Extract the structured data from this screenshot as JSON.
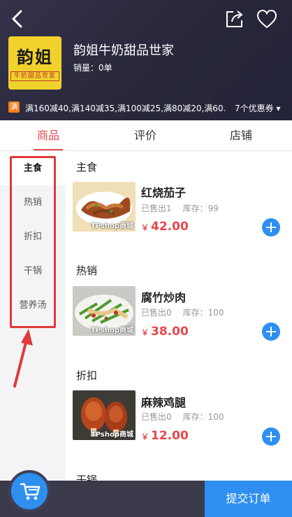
{
  "header": {
    "shop_name": "韵姐牛奶甜品世家",
    "sales": "销量：0单",
    "logo_big": "韵姐",
    "logo_small": "牛奶甜品世家",
    "promo_tag": "满",
    "promo_text": "满160减40,满140减35,满100减25,满80减20,满60...",
    "coupons": "7个优惠券 ▾"
  },
  "tabs": [
    {
      "label": "商品"
    },
    {
      "label": "评价"
    },
    {
      "label": "店铺"
    }
  ],
  "sidebar": {
    "items": [
      {
        "label": "主食"
      },
      {
        "label": "热销"
      },
      {
        "label": "折扣"
      },
      {
        "label": "干锅"
      },
      {
        "label": "营养汤"
      }
    ]
  },
  "sections": [
    {
      "title": "主食",
      "item": {
        "name": "红烧茄子",
        "sold": "已售出1",
        "stock": "库存：99",
        "currency": "￥",
        "price": "42.00",
        "watermark": "TPshop商城"
      }
    },
    {
      "title": "热销",
      "item": {
        "name": "腐竹炒肉",
        "sold": "已售出0",
        "stock": "库存：100",
        "currency": "￥",
        "price": "38.00",
        "watermark": "TPshop商城"
      }
    },
    {
      "title": "折扣",
      "item": {
        "name": "麻辣鸡腿",
        "sold": "已售出0",
        "stock": "库存：100",
        "currency": "￥",
        "price": "12.00",
        "watermark": "TPshop商城"
      }
    },
    {
      "title": "干锅"
    }
  ],
  "footer": {
    "submit_label": "提交订单"
  },
  "icons": {
    "back": "chevron-left-icon",
    "share": "share-icon",
    "favorite": "heart-icon",
    "cart": "cart-icon",
    "add": "plus-icon"
  },
  "colors": {
    "accent": "#e8474c",
    "primary": "#2e8ff0",
    "header_bg": "#2c2b40",
    "annotation": "#e03a3a"
  }
}
